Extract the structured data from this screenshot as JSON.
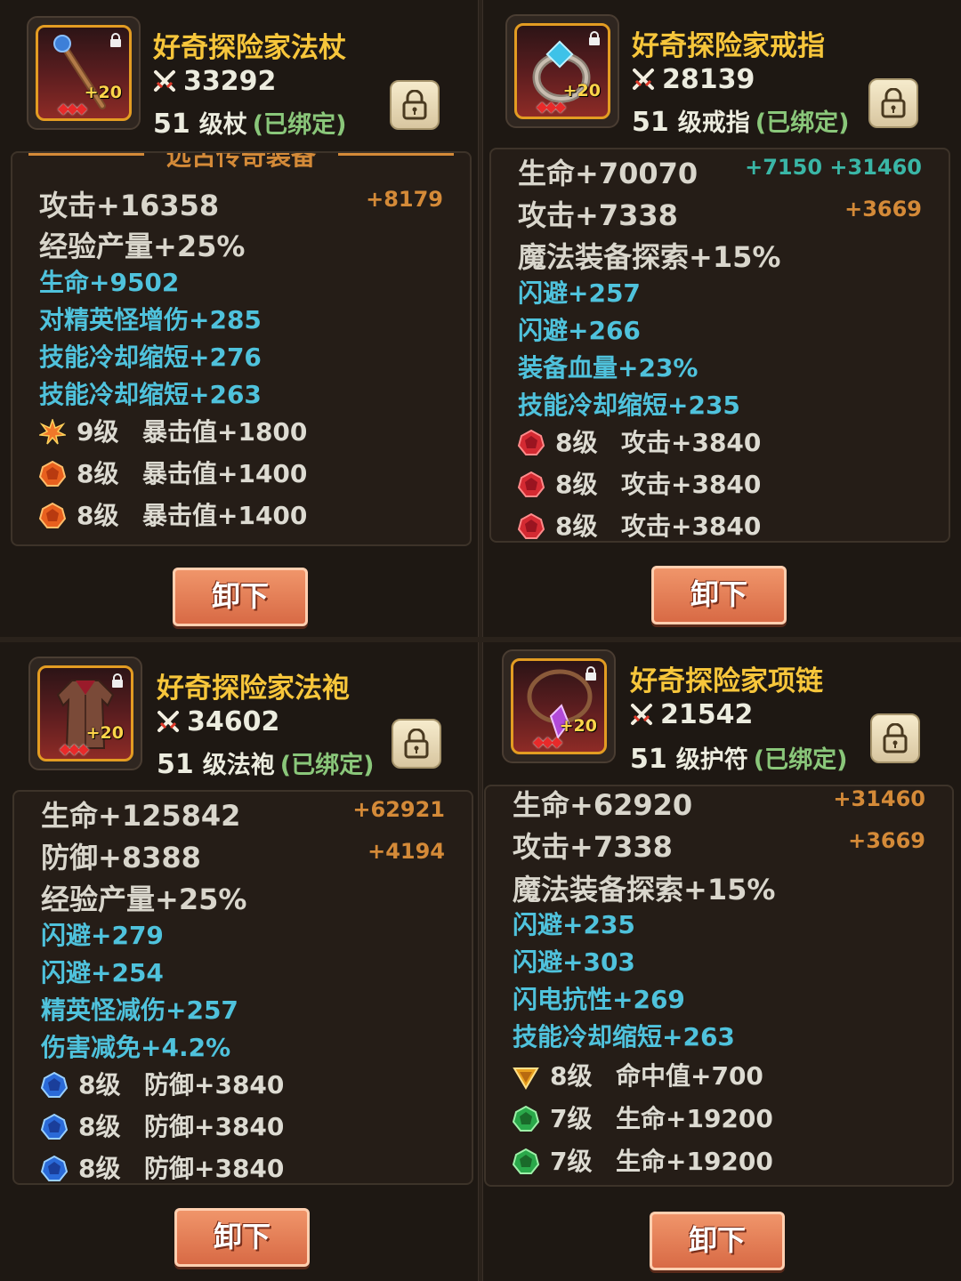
{
  "panels": [
    {
      "name": "好奇探险家法杖",
      "power": "33292",
      "level": "51",
      "type": "级杖",
      "bound": "(已绑定)",
      "plus": "+20",
      "section_title": "远古传奇装备",
      "main_stats": [
        {
          "text": "攻击+16358",
          "inc": "+8179"
        },
        {
          "text": "经验产量+25%",
          "inc": ""
        }
      ],
      "sub_stats": [
        "生命+9502",
        "对精英怪增伤+285",
        "技能冷却缩短+276",
        "技能冷却缩短+263"
      ],
      "gems": [
        {
          "icon": "sun-gem-icon",
          "level": "9级",
          "stat": "暴击值+1800"
        },
        {
          "icon": "orange-gem-icon",
          "level": "8级",
          "stat": "暴击值+1400"
        },
        {
          "icon": "orange-gem-icon",
          "level": "8级",
          "stat": "暴击值+1400"
        }
      ],
      "unload_label": "卸下"
    },
    {
      "name": "好奇探险家戒指",
      "power": "28139",
      "level": "51",
      "type": "级戒指",
      "bound": "(已绑定)",
      "plus": "+20",
      "main_stats": [
        {
          "text": "生命+70070",
          "inc": "+7150 +31460"
        },
        {
          "text": "攻击+7338",
          "inc": "+3669"
        },
        {
          "text": "魔法装备探索+15%",
          "inc": ""
        }
      ],
      "sub_stats": [
        "闪避+257",
        "闪避+266",
        "装备血量+23%",
        "技能冷却缩短+235"
      ],
      "gems": [
        {
          "icon": "red-gem-icon",
          "level": "8级",
          "stat": "攻击+3840"
        },
        {
          "icon": "red-gem-icon",
          "level": "8级",
          "stat": "攻击+3840"
        },
        {
          "icon": "red-gem-icon",
          "level": "8级",
          "stat": "攻击+3840"
        }
      ],
      "unload_label": "卸下"
    },
    {
      "name": "好奇探险家法袍",
      "power": "34602",
      "level": "51",
      "type": "级法袍",
      "bound": "(已绑定)",
      "plus": "+20",
      "main_stats": [
        {
          "text": "生命+125842",
          "inc": "+62921"
        },
        {
          "text": "防御+8388",
          "inc": "+4194"
        },
        {
          "text": "经验产量+25%",
          "inc": ""
        }
      ],
      "sub_stats": [
        "闪避+279",
        "闪避+254",
        "精英怪减伤+257",
        "伤害减免+4.2%"
      ],
      "gems": [
        {
          "icon": "blue-gem-icon",
          "level": "8级",
          "stat": "防御+3840"
        },
        {
          "icon": "blue-gem-icon",
          "level": "8级",
          "stat": "防御+3840"
        },
        {
          "icon": "blue-gem-icon",
          "level": "8级",
          "stat": "防御+3840"
        }
      ],
      "unload_label": "卸下"
    },
    {
      "name": "好奇探险家项链",
      "power": "21542",
      "level": "51",
      "type": "级护符",
      "bound": "(已绑定)",
      "plus": "+20",
      "main_stats": [
        {
          "text": "生命+62920",
          "inc": "+31460"
        },
        {
          "text": "攻击+7338",
          "inc": "+3669"
        },
        {
          "text": "魔法装备探索+15%",
          "inc": ""
        }
      ],
      "sub_stats": [
        "闪避+235",
        "闪避+303",
        "闪电抗性+269",
        "技能冷却缩短+263"
      ],
      "gems": [
        {
          "icon": "topaz-gem-icon",
          "level": "8级",
          "stat": "命中值+700"
        },
        {
          "icon": "green-gem-icon",
          "level": "7级",
          "stat": "生命+19200"
        },
        {
          "icon": "green-gem-icon",
          "level": "7级",
          "stat": "生命+19200"
        }
      ],
      "unload_label": "卸下"
    }
  ]
}
